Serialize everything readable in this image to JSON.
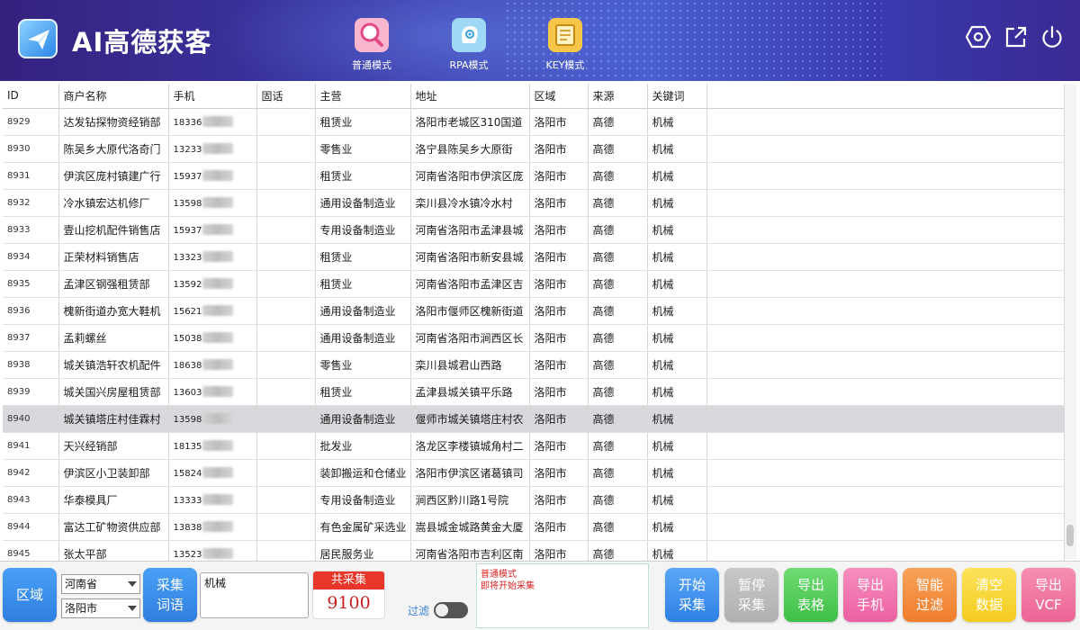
{
  "header": {
    "app_title": "AI高德获客",
    "modes": [
      {
        "label": "普通模式",
        "icon": "search-icon"
      },
      {
        "label": "RPA模式",
        "icon": "robot-head-icon"
      },
      {
        "label": "KEY模式",
        "icon": "key-map-icon"
      }
    ],
    "icons": [
      "settings-icon",
      "open-external-icon",
      "power-icon"
    ]
  },
  "table": {
    "columns": [
      "ID",
      "商户名称",
      "手机",
      "固话",
      "主营",
      "地址",
      "区域",
      "来源",
      "关键词"
    ],
    "selected_id": "8940",
    "rows": [
      {
        "id": "8929",
        "name": "达发钻探物资经销部",
        "phone": "18336",
        "landline": "",
        "business": "租赁业",
        "address": "洛阳市老城区310国道",
        "region": "洛阳市",
        "source": "高德",
        "keyword": "机械"
      },
      {
        "id": "8930",
        "name": "陈吴乡大原代洛奇门",
        "phone": "13233",
        "landline": "",
        "business": "零售业",
        "address": "洛宁县陈吴乡大原街",
        "region": "洛阳市",
        "source": "高德",
        "keyword": "机械"
      },
      {
        "id": "8931",
        "name": "伊滨区庞村镇建广行",
        "phone": "15937",
        "landline": "",
        "business": "租赁业",
        "address": "河南省洛阳市伊滨区庞",
        "region": "洛阳市",
        "source": "高德",
        "keyword": "机械"
      },
      {
        "id": "8932",
        "name": "冷水镇宏达机修厂",
        "phone": "13598",
        "landline": "",
        "business": "通用设备制造业",
        "address": "栾川县冷水镇冷水村",
        "region": "洛阳市",
        "source": "高德",
        "keyword": "机械"
      },
      {
        "id": "8933",
        "name": "壹山挖机配件销售店",
        "phone": "15937",
        "landline": "",
        "business": "专用设备制造业",
        "address": "河南省洛阳市孟津县城",
        "region": "洛阳市",
        "source": "高德",
        "keyword": "机械"
      },
      {
        "id": "8934",
        "name": "正荣材料销售店",
        "phone": "13323",
        "landline": "",
        "business": "租赁业",
        "address": "河南省洛阳市新安县城",
        "region": "洛阳市",
        "source": "高德",
        "keyword": "机械"
      },
      {
        "id": "8935",
        "name": "孟津区钢强租赁部",
        "phone": "13592",
        "landline": "",
        "business": "租赁业",
        "address": "河南省洛阳市孟津区吉",
        "region": "洛阳市",
        "source": "高德",
        "keyword": "机械"
      },
      {
        "id": "8936",
        "name": "槐新街道办宽大鞋机",
        "phone": "15621",
        "landline": "",
        "business": "通用设备制造业",
        "address": "洛阳市偃师区槐新街道",
        "region": "洛阳市",
        "source": "高德",
        "keyword": "机械"
      },
      {
        "id": "8937",
        "name": "孟莉螺丝",
        "phone": "15038",
        "landline": "",
        "business": "通用设备制造业",
        "address": "河南省洛阳市涧西区长",
        "region": "洛阳市",
        "source": "高德",
        "keyword": "机械"
      },
      {
        "id": "8938",
        "name": "城关镇浩轩农机配件",
        "phone": "18638",
        "landline": "",
        "business": "零售业",
        "address": "栾川县城君山西路",
        "region": "洛阳市",
        "source": "高德",
        "keyword": "机械"
      },
      {
        "id": "8939",
        "name": "城关国兴房屋租赁部",
        "phone": "13603",
        "landline": "",
        "business": "租赁业",
        "address": "孟津县城关镇平乐路",
        "region": "洛阳市",
        "source": "高德",
        "keyword": "机械"
      },
      {
        "id": "8940",
        "name": "城关镇塔庄村佳霖村",
        "phone": "13598",
        "landline": "",
        "business": "通用设备制造业",
        "address": "偃师市城关镇塔庄村农",
        "region": "洛阳市",
        "source": "高德",
        "keyword": "机械"
      },
      {
        "id": "8941",
        "name": "天兴经销部",
        "phone": "18135",
        "landline": "",
        "business": "批发业",
        "address": "洛龙区李楼镇城角村二",
        "region": "洛阳市",
        "source": "高德",
        "keyword": "机械"
      },
      {
        "id": "8942",
        "name": "伊滨区小卫装卸部",
        "phone": "15824",
        "landline": "",
        "business": "装卸搬运和仓储业",
        "address": "洛阳市伊滨区诸葛镇司",
        "region": "洛阳市",
        "source": "高德",
        "keyword": "机械"
      },
      {
        "id": "8943",
        "name": "华泰模具厂",
        "phone": "13333",
        "landline": "",
        "business": "专用设备制造业",
        "address": "涧西区黔川路1号院",
        "region": "洛阳市",
        "source": "高德",
        "keyword": "机械"
      },
      {
        "id": "8944",
        "name": "富达工矿物资供应部",
        "phone": "13838",
        "landline": "",
        "business": "有色金属矿采选业",
        "address": "嵩县城金城路黄金大厦",
        "region": "洛阳市",
        "source": "高德",
        "keyword": "机械"
      },
      {
        "id": "8945",
        "name": "张太平部",
        "phone": "13523",
        "landline": "",
        "business": "居民服务业",
        "address": "河南省洛阳市吉利区南",
        "region": "洛阳市",
        "source": "高德",
        "keyword": "机械"
      }
    ]
  },
  "controls": {
    "region_button": "区域",
    "province": "河南省",
    "city": "洛阳市",
    "collect_words_button": [
      "采集",
      "词语"
    ],
    "keyword_value": "机械",
    "count_title": "共采集",
    "count_value": "9100",
    "filter_label": "过滤",
    "filter_on": false,
    "log_lines": [
      "普通模式",
      "即将开始采集"
    ],
    "buttons": {
      "start": [
        "开始",
        "采集"
      ],
      "pause": [
        "暂停",
        "采集"
      ],
      "export_table": [
        "导出",
        "表格"
      ],
      "export_phone": [
        "导出",
        "手机"
      ],
      "smart_filter": [
        "智能",
        "过滤"
      ],
      "clear_data": [
        "清空",
        "数据"
      ],
      "export_vcf": [
        "导出",
        "VCF"
      ]
    }
  },
  "colors": {
    "header_gradient": [
      "#35217e",
      "#4a5fd0"
    ],
    "selected_row": "#d9d9dd",
    "count_red": "#e8362a"
  }
}
